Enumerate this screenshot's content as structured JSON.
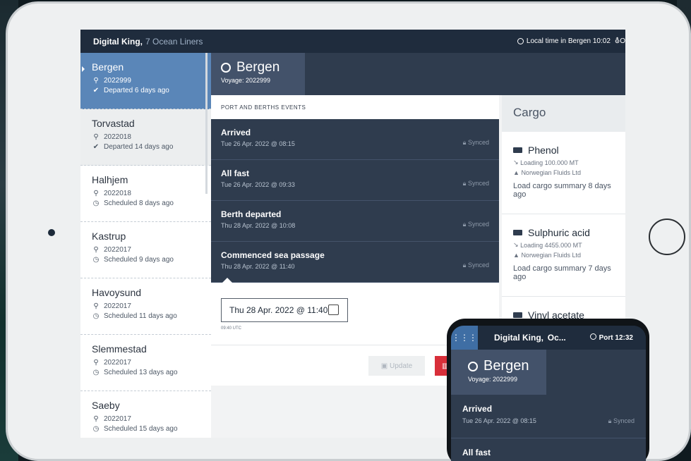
{
  "app": {
    "ship_name": "Digital King,",
    "fleet": "7 Ocean Liners",
    "local_time": "Local time in Bergen 10:02",
    "local_tail": "O"
  },
  "sidebar": {
    "items": [
      {
        "name": "Bergen",
        "voyage": "2022999",
        "status": "Departed 6 days ago",
        "status_icon": "check-icon"
      },
      {
        "name": "Torvastad",
        "voyage": "2022018",
        "status": "Departed 14 days ago",
        "status_icon": "check-icon"
      },
      {
        "name": "Halhjem",
        "voyage": "2022018",
        "status": "Scheduled 8 days ago",
        "status_icon": "clock-icon"
      },
      {
        "name": "Kastrup",
        "voyage": "2022017",
        "status": "Scheduled 9 days ago",
        "status_icon": "clock-icon"
      },
      {
        "name": "Havoysund",
        "voyage": "2022017",
        "status": "Scheduled 11 days ago",
        "status_icon": "clock-icon"
      },
      {
        "name": "Slemmestad",
        "voyage": "2022017",
        "status": "Scheduled 13 days ago",
        "status_icon": "clock-icon"
      },
      {
        "name": "Saeby",
        "voyage": "2022017",
        "status": "Scheduled 15 days ago",
        "status_icon": "clock-icon"
      }
    ]
  },
  "header": {
    "port": "Bergen",
    "voyage": "Voyage: 2022999"
  },
  "events": {
    "heading": "PORT AND BERTHS EVENTS",
    "items": [
      {
        "title": "Arrived",
        "date": "Tue 26 Apr. 2022 @ 08:15",
        "status": "Synced"
      },
      {
        "title": "All fast",
        "date": "Tue 26 Apr. 2022 @ 09:33",
        "status": "Synced"
      },
      {
        "title": "Berth departed",
        "date": "Thu 28 Apr. 2022 @ 10:08",
        "status": "Synced"
      },
      {
        "title": "Commenced sea passage",
        "date": "Thu 28 Apr. 2022 @ 11:40",
        "status": "Synced"
      }
    ],
    "edit": {
      "date_value": "Thu 28 Apr. 2022 @ 11:40",
      "utc": "09:40 UTC"
    },
    "update_label": "Update"
  },
  "cargo": {
    "heading": "Cargo",
    "items": [
      {
        "name": "Phenol",
        "loading": "Loading 100.000 MT",
        "company": "Norwegian Fluids Ltd",
        "summary": "Load cargo summary 8 days ago"
      },
      {
        "name": "Sulphuric acid",
        "loading": "Loading 4455.000 MT",
        "company": "Norwegian Fluids Ltd",
        "summary": "Load cargo summary 7 days ago"
      },
      {
        "name": "Vinyl acetate"
      }
    ]
  },
  "phone": {
    "title": "Digital King,  Oc...",
    "port_time": "Port 12:32",
    "port": "Bergen",
    "voyage": "Voyage: 2022999",
    "events": [
      {
        "title": "Arrived",
        "date": "Tue 26 Apr. 2022 @ 08:15",
        "status": "Synced"
      },
      {
        "title": "All fast"
      }
    ]
  }
}
